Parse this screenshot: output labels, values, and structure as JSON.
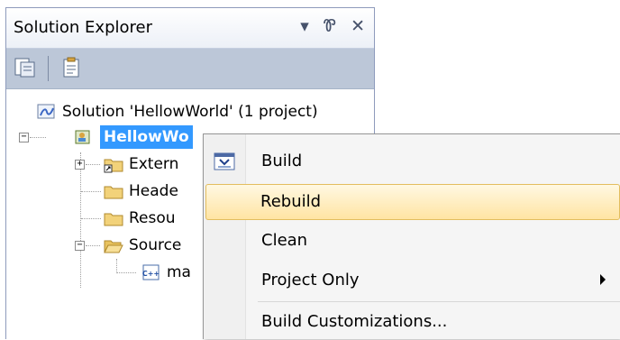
{
  "panel": {
    "title": "Solution Explorer",
    "title_icons": {
      "dropdown": "▾",
      "pin": "Ꮘ",
      "close": "✕"
    }
  },
  "tree": {
    "solution": "Solution 'HellowWorld' (1 project)",
    "project": "HellowWo",
    "items": [
      "Extern",
      "Heade",
      "Resou",
      "Source",
      "ma"
    ]
  },
  "menu": {
    "items": [
      {
        "label": "Build"
      },
      {
        "label": "Rebuild"
      },
      {
        "label": "Clean"
      },
      {
        "label": "Project Only"
      },
      {
        "label": "Build Customizations..."
      }
    ]
  }
}
